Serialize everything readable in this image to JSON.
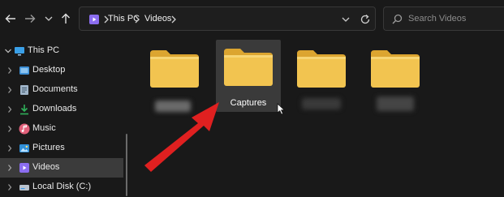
{
  "toolbar": {
    "back_icon": "arrow-left-icon",
    "forward_icon": "arrow-right-icon",
    "recent_icon": "chevron-down-icon",
    "up_icon": "arrow-up-icon"
  },
  "address_bar": {
    "crumbs": [
      "This PC",
      "Videos"
    ],
    "dropdown_icon": "chevron-down-icon",
    "refresh_icon": "refresh-icon"
  },
  "search": {
    "placeholder": "Search Videos",
    "icon": "search-icon"
  },
  "sidebar": {
    "items": [
      {
        "label": "This PC",
        "icon": "monitor-icon",
        "expanded": true
      },
      {
        "label": "Desktop",
        "icon": "desktop-folder-icon"
      },
      {
        "label": "Documents",
        "icon": "document-icon"
      },
      {
        "label": "Downloads",
        "icon": "download-icon"
      },
      {
        "label": "Music",
        "icon": "music-icon"
      },
      {
        "label": "Pictures",
        "icon": "picture-icon"
      },
      {
        "label": "Videos",
        "icon": "video-icon",
        "selected": true
      },
      {
        "label": "Local Disk (C:)",
        "icon": "drive-icon"
      }
    ]
  },
  "content": {
    "folders": [
      {
        "name": "",
        "label_obscured": true
      },
      {
        "name": "Captures",
        "hovered": true
      },
      {
        "name": "",
        "label_obscured": true
      },
      {
        "name": "",
        "label_obscured": true
      }
    ],
    "annotation": {
      "type": "red-arrow",
      "points_to": "Captures"
    }
  },
  "colors": {
    "background": "#191919",
    "folder_yellow": "#f2c450",
    "selection": "#3b3b3b",
    "arrow_red": "#e02020",
    "videos_accent": "#8b6df0"
  }
}
